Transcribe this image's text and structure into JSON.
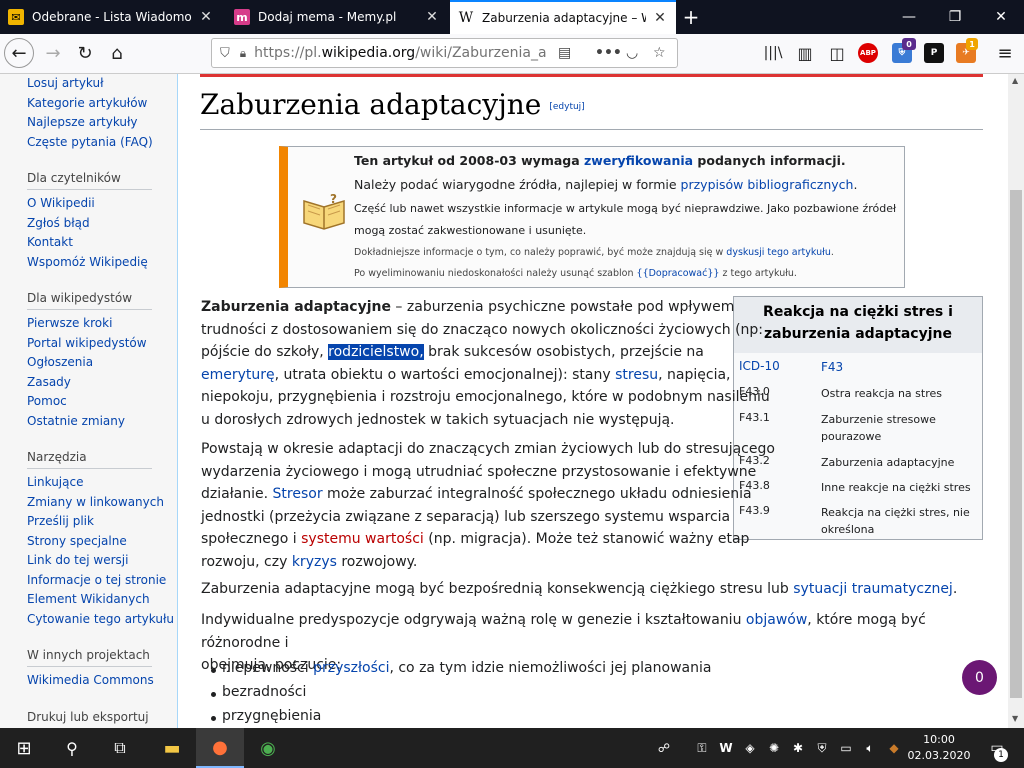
{
  "browser": {
    "tabs": [
      {
        "title": "Odebrane - Lista Wiadomości -",
        "icon": "mail-icon",
        "active": false
      },
      {
        "title": "Dodaj mema - Memy.pl",
        "icon": "memy-icon",
        "active": false
      },
      {
        "title": "Zaburzenia adaptacyjne – Wikip",
        "icon": "wikipedia-icon",
        "active": true
      }
    ],
    "url_prefix": "https://pl.",
    "url_domain": "wikipedia.org",
    "url_path": "/wiki/Zaburzenia_a",
    "ext_badges": {
      "shield": "0",
      "notifications": "1"
    },
    "abp": "ABP"
  },
  "sidebar": {
    "groups": [
      {
        "heading": null,
        "items": [
          "Losuj artykuł",
          "Kategorie artykułów",
          "Najlepsze artykuły",
          "Częste pytania (FAQ)"
        ]
      },
      {
        "heading": "Dla czytelników",
        "items": [
          "O Wikipedii",
          "Zgłoś błąd",
          "Kontakt",
          "Wspomóż Wikipedię"
        ]
      },
      {
        "heading": "Dla wikipedystów",
        "items": [
          "Pierwsze kroki",
          "Portal wikipedystów",
          "Ogłoszenia",
          "Zasady",
          "Pomoc",
          "Ostatnie zmiany"
        ]
      },
      {
        "heading": "Narzędzia",
        "items": [
          "Linkujące",
          "Zmiany w linkowanych",
          "Prześlij plik",
          "Strony specjalne",
          "Link do tej wersji",
          "Informacje o tej stronie",
          "Element Wikidanych",
          "Cytowanie tego artykułu"
        ]
      },
      {
        "heading": "W innych projektach",
        "items": [
          "Wikimedia Commons"
        ]
      },
      {
        "heading": "Drukuj lub eksportuj",
        "items": []
      }
    ]
  },
  "article": {
    "title": "Zaburzenia adaptacyjne",
    "edit": "[edytuj]",
    "ambox": {
      "l1a": "Ten artykuł od 2008-03 wymaga ",
      "l1b": "zweryfikowania",
      "l1c": " podanych informacji.",
      "l2a": "Należy podać wiarygodne źródła, najlepiej w formie ",
      "l2b": "przypisów bibliograficznych",
      "l2c": ".",
      "l3": "Część lub nawet wszystkie informacje w artykule mogą być nieprawdziwe. Jako pozbawione źródeł",
      "l4": "mogą zostać zakwestionowane i usunięte.",
      "l5a": "Dokładniejsze informacje o tym, co należy poprawić, być może znajdują się w ",
      "l5b": "dyskusji tego artykułu",
      "l5c": ".",
      "l6a": "Po wyeliminowaniu niedoskonałości należy usunąć szablon ",
      "l6b": "{{Dopracować}}",
      "l6c": " z tego artykułu."
    },
    "infobox": {
      "title1": "Reakcja na ciężki stres i",
      "title2": "zaburzenia adaptacyjne",
      "icd_label": "ICD-10",
      "icd_code": "F43",
      "rows": [
        {
          "code": "F43.0",
          "desc": "Ostra reakcja na stres"
        },
        {
          "code": "F43.1",
          "desc": "Zaburzenie stresowe pourazowe"
        },
        {
          "code": "F43.2",
          "desc": "Zaburzenia adaptacyjne"
        },
        {
          "code": "F43.8",
          "desc": "Inne reakcje na ciężki stres"
        },
        {
          "code": "F43.9",
          "desc": "Reakcja na ciężki stres, nie określona"
        }
      ]
    },
    "p1": {
      "b": "Zaburzenia adaptacyjne",
      "t1": " – zaburzenia psychiczne powstałe pod wpływem",
      "t2": "trudności z dostosowaniem się do znacząco nowych okoliczności życiowych (np:",
      "t3": "pójście do szkoły, ",
      "sel": "rodzicielstwo,",
      "t4": " brak sukcesów osobistych, przejście na",
      "link1": "emeryturę",
      "t5": ", utrata obiektu o wartości emocjonalnej): stany ",
      "link2": "stresu",
      "t6": ", napięcia,",
      "t7": "niepokoju, przygnębienia i rozstroju emocjonalnego, które w podobnym nasileniu",
      "t8": "u dorosłych zdrowych jednostek w takich sytuacjach nie występują."
    },
    "p2": {
      "t1": "Powstają w okresie adaptacji do znaczących zmian życiowych lub do stresującego",
      "t2": "wydarzenia życiowego i mogą utrudniać społeczne przystosowanie i efektywne",
      "t3": "działanie. ",
      "link1": "Stresor",
      "t4": " może zaburzać integralność społecznego układu odniesienia",
      "t5": "jednostki (przeżycia związane z separacją) lub szerszego systemu wsparcia",
      "t6": "społecznego i ",
      "link2": "systemu wartości",
      "t7": " (np. migracja). Może też stanowić ważny etap",
      "t8": "rozwoju, czy ",
      "link3": "kryzys",
      "t9": " rozwojowy."
    },
    "p3": {
      "t1": "Zaburzenia adaptacyjne mogą być bezpośrednią konsekwencją ciężkiego stresu lub ",
      "link": "sytuacji traumatycznej",
      "t2": "."
    },
    "p4": {
      "t1": "Indywidualne predyspozycje odgrywają ważną rolę w genezie i kształtowaniu ",
      "link": "objawów",
      "t2": ", które mogą być różnorodne i",
      "t3": "obejmują, poczucie:"
    },
    "list": [
      {
        "t1": "niepewności ",
        "link": "przyszłości",
        "t2": ", co za tym idzie niemożliwości jej planowania"
      },
      {
        "t1": "bezradności",
        "link": "",
        "t2": ""
      },
      {
        "t1": "przygnębienia",
        "link": "",
        "t2": ""
      }
    ],
    "float_badge": "0"
  },
  "taskbar": {
    "time": "10:00",
    "date": "02.03.2020",
    "notif": "1"
  },
  "colors": {
    "link": "#0645ad",
    "selection": "#0645ad",
    "ambox_border": "#f28500",
    "red_line": "#d33"
  }
}
